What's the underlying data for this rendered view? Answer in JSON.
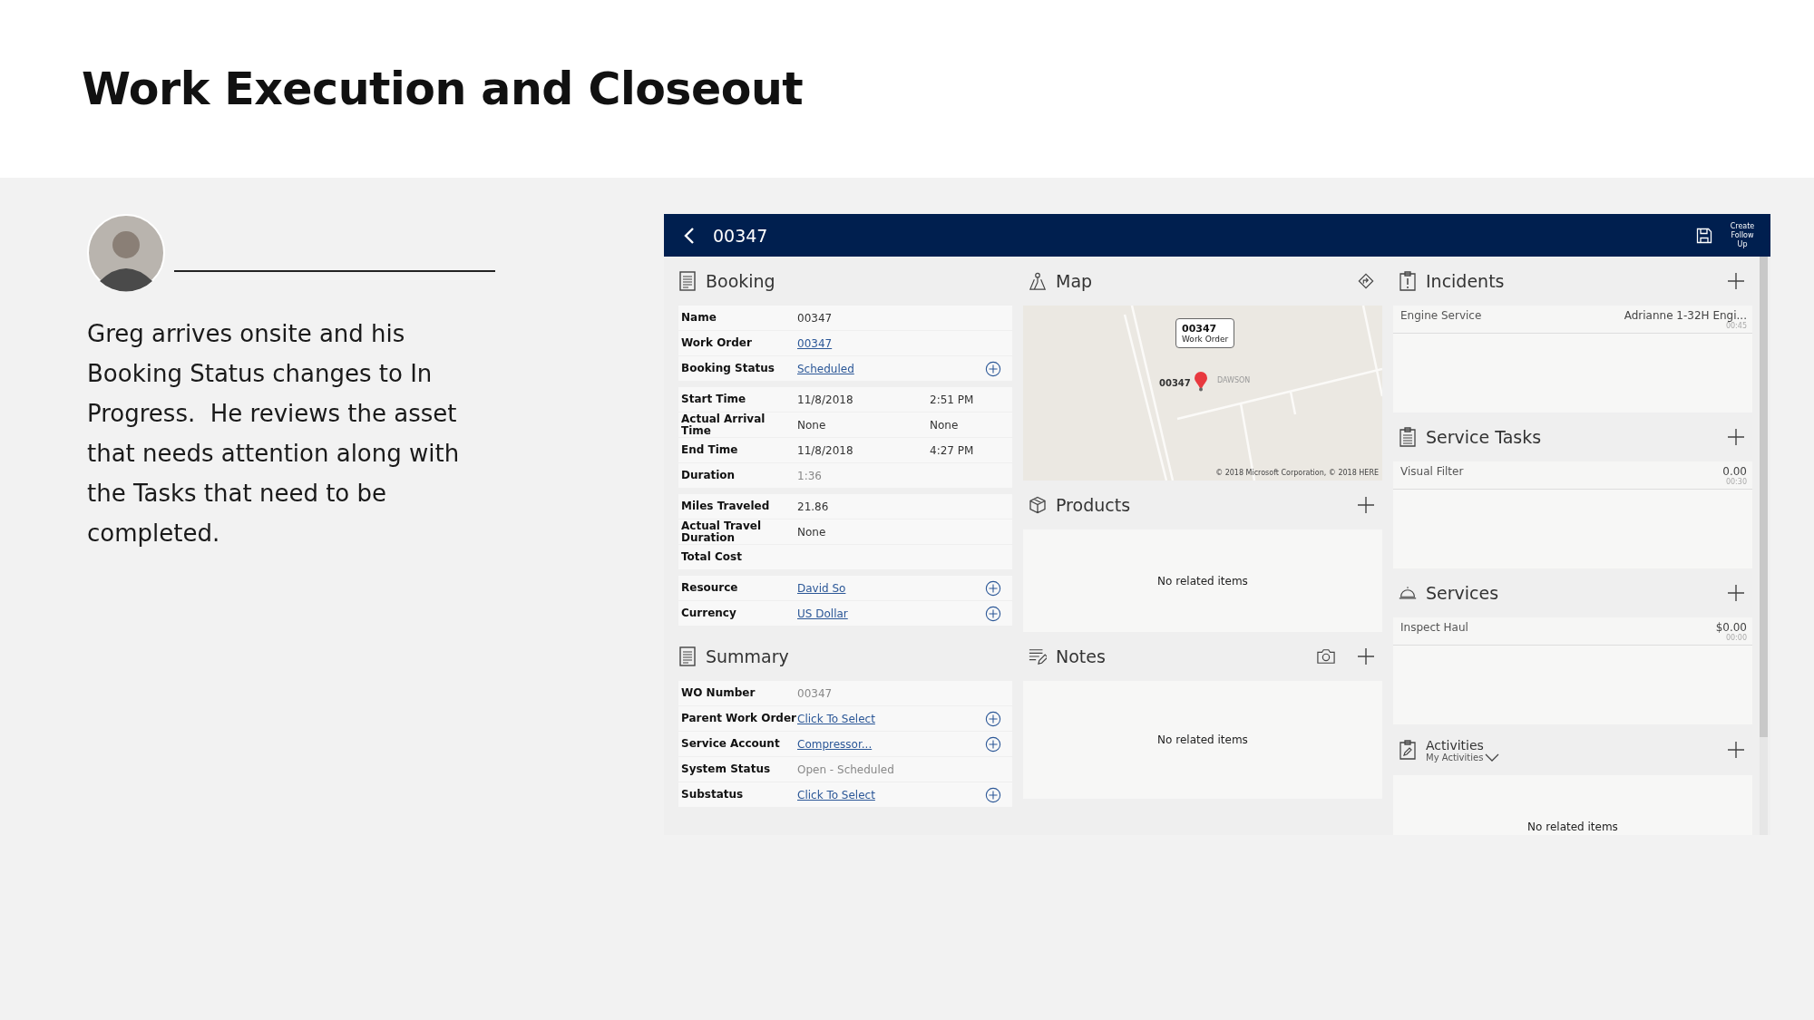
{
  "slide": {
    "title": "Work Execution and Closeout",
    "paragraph": "Greg arrives onsite and his Booking Status changes to In Progress.  He reviews the asset that needs attention along with the Tasks that need to be completed."
  },
  "app": {
    "title": "00347",
    "follow_up": "Create Follow Up",
    "booking": {
      "title": "Booking",
      "groups": [
        [
          {
            "label": "Name",
            "kind": "text",
            "value": "00347",
            "add": false
          },
          {
            "label": "Work Order",
            "kind": "link",
            "value": "00347",
            "add": false
          },
          {
            "label": "Booking Status",
            "kind": "link",
            "value": "Scheduled",
            "add": true
          }
        ],
        [
          {
            "label": "Start Time",
            "kind": "text",
            "value": "11/8/2018",
            "value_2": "2:51 PM",
            "add": false
          },
          {
            "label": "Actual Arrival Time",
            "kind": "text",
            "value": "None",
            "value_2": "None",
            "add": false
          },
          {
            "label": "End Time",
            "kind": "text",
            "value": "11/8/2018",
            "value_2": "4:27 PM",
            "add": false
          },
          {
            "label": "Duration",
            "kind": "muted",
            "value": "1:36",
            "add": false
          }
        ],
        [
          {
            "label": "Miles Traveled",
            "kind": "text",
            "value": "21.86",
            "add": false
          },
          {
            "label": "Actual Travel Duration",
            "kind": "text",
            "value": "None",
            "add": false
          },
          {
            "label": "Total Cost",
            "add": false
          }
        ],
        [
          {
            "label": "Resource",
            "kind": "link",
            "value": "David So",
            "add": true
          },
          {
            "label": "Currency",
            "kind": "link",
            "value": "US Dollar",
            "add": true
          }
        ]
      ]
    },
    "summary": {
      "title": "Summary",
      "groups": [
        [
          {
            "label": "WO Number",
            "kind": "muted",
            "value": "00347",
            "add": false
          },
          {
            "label": "Parent Work Order",
            "kind": "link",
            "value": "Click To Select",
            "add": true
          },
          {
            "label": "Service Account",
            "kind": "link",
            "value": "Compressor...",
            "add": true
          },
          {
            "label": "System Status",
            "kind": "muted",
            "value": "Open - Scheduled",
            "add": false
          },
          {
            "label": "Substatus",
            "kind": "link",
            "value": "Click To Select",
            "add": true
          }
        ]
      ]
    },
    "map": {
      "title": "Map",
      "card_id": "00347",
      "card_label": "Work Order",
      "pin_label": "00347",
      "place": "DAWSON",
      "copyright": "© 2018 Microsoft Corporation, © 2018 HERE"
    },
    "products": {
      "title": "Products",
      "empty": "No related items"
    },
    "notes": {
      "title": "Notes",
      "empty": "No related items"
    },
    "incidents": {
      "title": "Incidents",
      "items": [
        {
          "name": "Engine Service",
          "detail": "Adrianne  1-32H Engi...",
          "time": "00:45"
        }
      ]
    },
    "service_tasks": {
      "title": "Service Tasks",
      "items": [
        {
          "name": "Visual Filter",
          "detail": "0.00",
          "time": "00:30"
        }
      ]
    },
    "services": {
      "title": "Services",
      "items": [
        {
          "name": "Inspect Haul",
          "detail": "$0.00",
          "time": "00:00"
        }
      ]
    },
    "activities": {
      "title": "Activities",
      "filter": "My Activities",
      "empty": "No related items"
    }
  }
}
